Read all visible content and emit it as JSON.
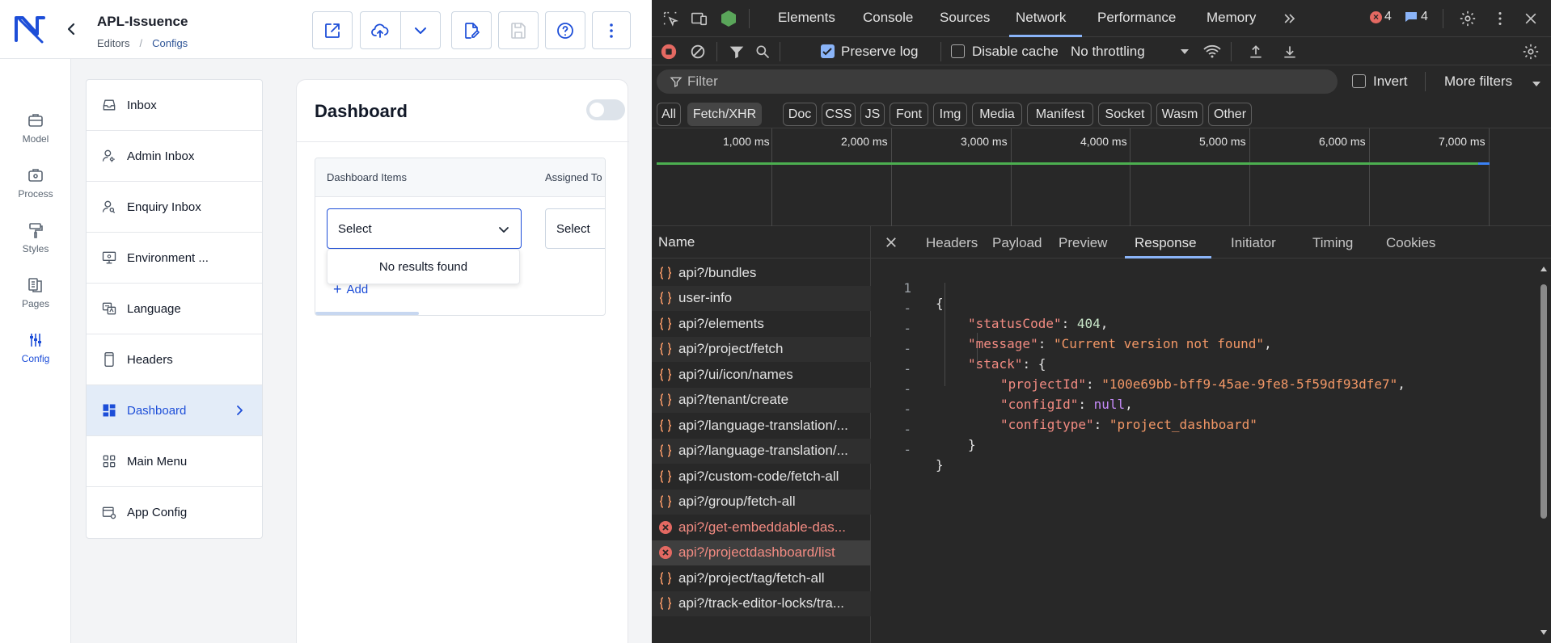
{
  "header": {
    "app_title": "APL-Issuence",
    "breadcrumb": [
      "Editors",
      "Configs"
    ],
    "breadcrumb_sep": "/"
  },
  "rail": [
    {
      "label": "Model",
      "icon": "model-icon"
    },
    {
      "label": "Process",
      "icon": "process-icon"
    },
    {
      "label": "Styles",
      "icon": "styles-icon"
    },
    {
      "label": "Pages",
      "icon": "pages-icon"
    },
    {
      "label": "Config",
      "icon": "config-icon",
      "active": true
    }
  ],
  "config_items": [
    {
      "label": "Inbox"
    },
    {
      "label": "Admin Inbox"
    },
    {
      "label": "Enquiry Inbox"
    },
    {
      "label": "Environment ..."
    },
    {
      "label": "Language"
    },
    {
      "label": "Headers"
    },
    {
      "label": "Dashboard",
      "active": true
    },
    {
      "label": "Main Menu"
    },
    {
      "label": "App Config"
    }
  ],
  "dashboard": {
    "title": "Dashboard",
    "col_items": "Dashboard Items",
    "col_assigned": "Assigned To",
    "select_placeholder": "Select",
    "assigned_placeholder": "Select",
    "add_label": "Add",
    "no_results": "No results found"
  },
  "devtools": {
    "tabs": [
      "Elements",
      "Console",
      "Sources",
      "Network",
      "Performance",
      "Memory"
    ],
    "active_tab": "Network",
    "error_count": "4",
    "message_count": "4",
    "toolbar": {
      "preserve_log": "Preserve log",
      "disable_cache": "Disable cache",
      "throttling": "No throttling"
    },
    "filter_placeholder": "Filter",
    "invert": "Invert",
    "more_filters": "More filters",
    "types": [
      "All",
      "Fetch/XHR",
      "Doc",
      "CSS",
      "JS",
      "Font",
      "Img",
      "Media",
      "Manifest",
      "Socket",
      "Wasm",
      "Other"
    ],
    "timeline_labels": [
      "1,000 ms",
      "2,000 ms",
      "3,000 ms",
      "4,000 ms",
      "5,000 ms",
      "6,000 ms",
      "7,000 ms"
    ],
    "name_header": "Name",
    "requests": [
      {
        "name": "api?/bundles",
        "status": "ok"
      },
      {
        "name": "user-info",
        "status": "ok"
      },
      {
        "name": "api?/elements",
        "status": "ok"
      },
      {
        "name": "api?/project/fetch",
        "status": "ok"
      },
      {
        "name": "api?/ui/icon/names",
        "status": "ok"
      },
      {
        "name": "api?/tenant/create",
        "status": "ok"
      },
      {
        "name": "api?/language-translation/...",
        "status": "ok"
      },
      {
        "name": "api?/language-translation/...",
        "status": "ok"
      },
      {
        "name": "api?/custom-code/fetch-all",
        "status": "ok"
      },
      {
        "name": "api?/group/fetch-all",
        "status": "ok"
      },
      {
        "name": "api?/get-embeddable-das...",
        "status": "error"
      },
      {
        "name": "api?/projectdashboard/list",
        "status": "error",
        "selected": true
      },
      {
        "name": "api?/project/tag/fetch-all",
        "status": "ok"
      },
      {
        "name": "api?/track-editor-locks/tra...",
        "status": "ok"
      }
    ],
    "detail_tabs": [
      "Headers",
      "Payload",
      "Preview",
      "Response",
      "Initiator",
      "Timing",
      "Cookies"
    ],
    "active_detail_tab": "Response",
    "response": {
      "statusCode_key": "\"statusCode\"",
      "statusCode": "404",
      "message_key": "\"message\"",
      "message": "\"Current version not found\"",
      "stack_key": "\"stack\"",
      "projectId_key": "\"projectId\"",
      "projectId": "\"100e69bb-bff9-45ae-9fe8-5f59df93dfe7\"",
      "configId_key": "\"configId\"",
      "configId": "null",
      "configtype_key": "\"configtype\"",
      "configtype": "\"project_dashboard\""
    },
    "line_numbers": [
      "1",
      "-",
      "-",
      "-",
      "-",
      "-",
      "-",
      "-",
      "-"
    ]
  },
  "colors": {
    "brand_blue": "#1d4ed8",
    "devtools_bg": "#282828",
    "error_red": "#f28b82",
    "json_key": "#f28b82",
    "json_string": "#f29766"
  }
}
